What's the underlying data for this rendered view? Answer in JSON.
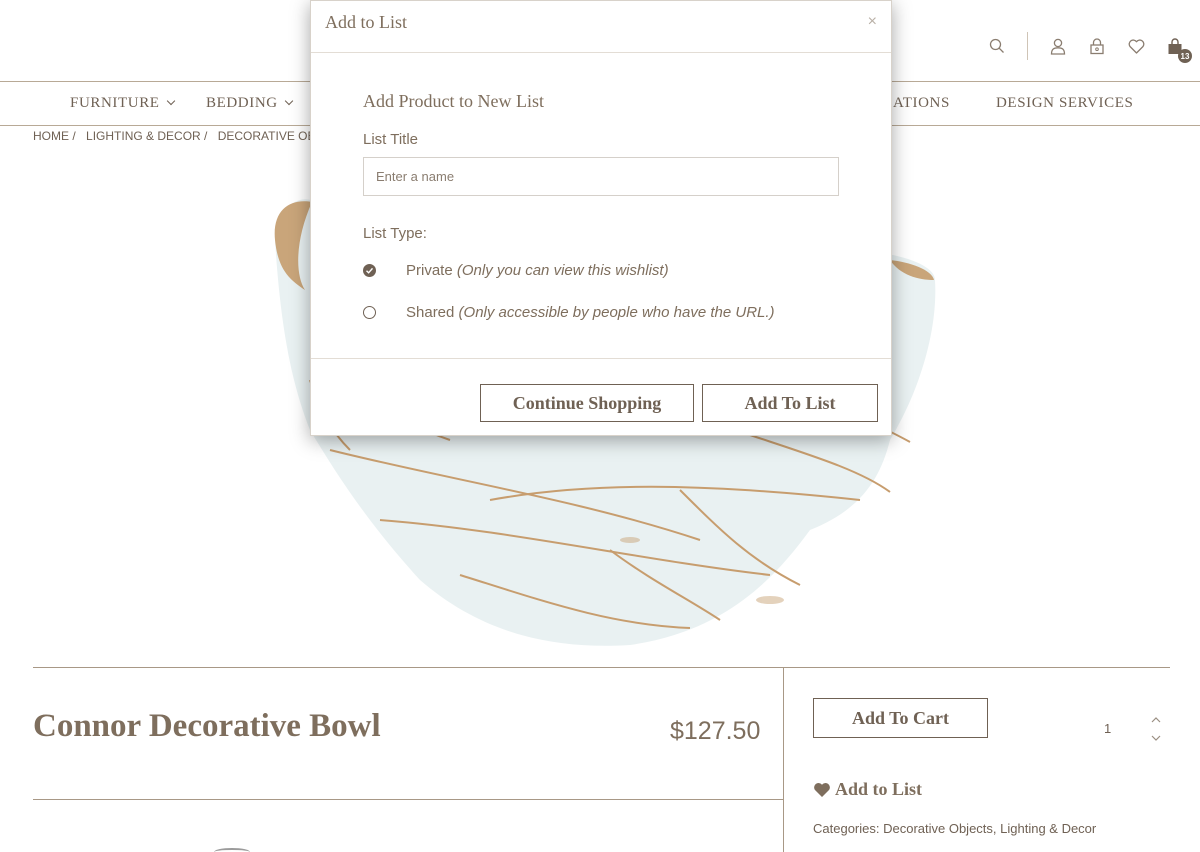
{
  "header": {
    "icons": [
      "search-icon",
      "user-icon",
      "lock-icon",
      "heart-icon",
      "bag-icon"
    ],
    "cart_count": "13"
  },
  "nav": {
    "items": [
      {
        "label": "FURNITURE",
        "has_dropdown": true
      },
      {
        "label": "BEDDING",
        "has_dropdown": true
      },
      {
        "label": "ATIONS",
        "has_dropdown": false
      },
      {
        "label": "DESIGN SERVICES",
        "has_dropdown": false
      }
    ]
  },
  "breadcrumb": [
    "HOME /",
    "LIGHTING & DECOR /",
    "DECORATIVE OBJE"
  ],
  "product": {
    "title": "Connor Decorative Bowl",
    "price": "$127.50",
    "add_to_cart": "Add To Cart",
    "quantity": "1",
    "add_to_list": "Add to List",
    "categories": "Categories: Decorative Objects, Lighting & Decor"
  },
  "modal": {
    "title": "Add to List",
    "close": "×",
    "subtitle": "Add Product to New List",
    "list_title_label": "List Title",
    "name_placeholder": "Enter a name",
    "name_value": "",
    "list_type_label": "List Type:",
    "options": [
      {
        "label": "Private",
        "note": "(Only you can view this wishlist)",
        "checked": true
      },
      {
        "label": "Shared",
        "note": "(Only accessible by people who have the URL.)",
        "checked": false
      }
    ],
    "continue_button": "Continue Shopping",
    "add_button": "Add To List"
  },
  "colors": {
    "brand_brown": "#6f6154",
    "text_brown": "#7e6e5d",
    "divider": "#b8a996"
  }
}
